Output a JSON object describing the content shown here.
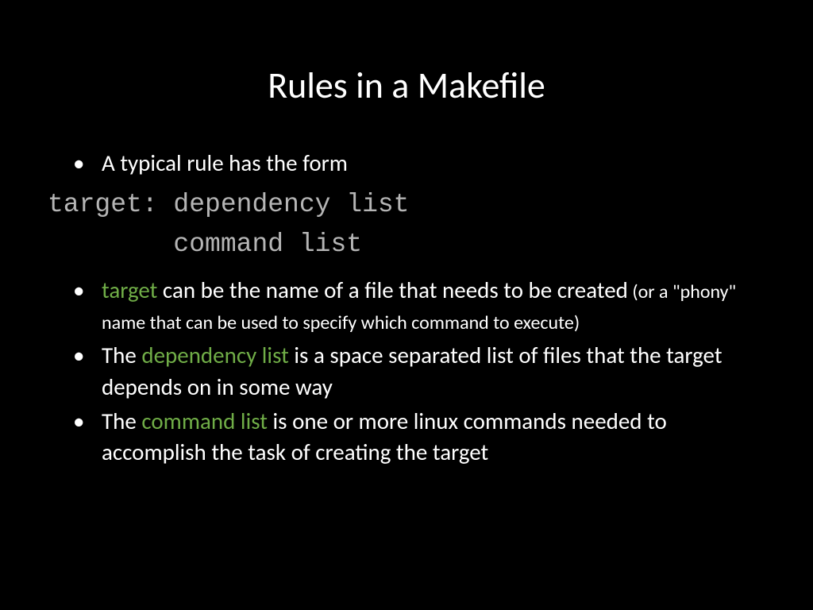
{
  "slide": {
    "title": "Rules in a Makefile",
    "bullet1": "A typical rule has the form",
    "code_line1": "target: dependency list",
    "code_line2": "        command list",
    "bullet2": {
      "highlight": "target",
      "text_part1": " can be the name of a file that needs to be created",
      "small": " (or a \"phony\" name that can be used to specify which command to execute)"
    },
    "bullet3": {
      "prefix": "The ",
      "highlight": "dependency list",
      "suffix": " is a space separated list of files that the target depends on in some way"
    },
    "bullet4": {
      "prefix": "The ",
      "highlight": "command list",
      "suffix": " is one or more linux commands needed to accomplish the task of creating the target"
    },
    "bullet_marker": "•"
  }
}
